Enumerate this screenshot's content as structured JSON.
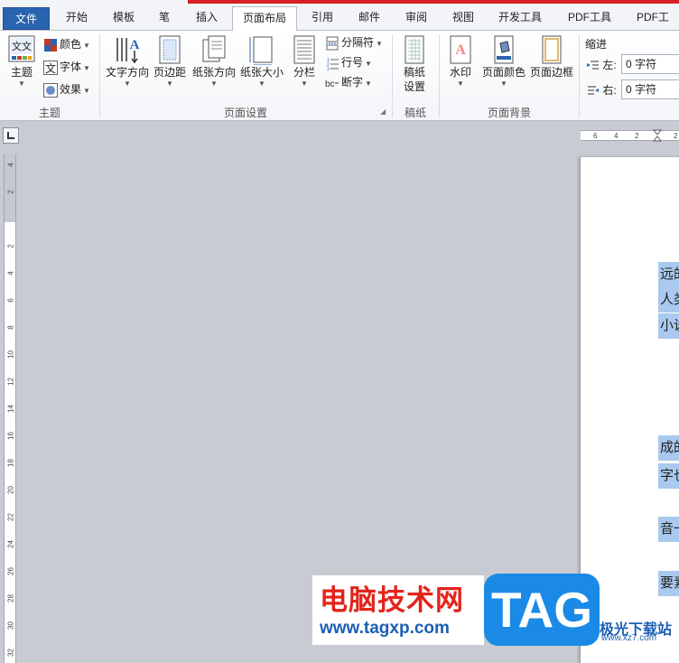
{
  "tabs": {
    "file": "文件",
    "items": [
      "开始",
      "模板",
      "笔",
      "插入",
      "页面布局",
      "引用",
      "邮件",
      "审阅",
      "视图",
      "开发工具",
      "PDF工具",
      "PDF工"
    ],
    "active": "页面布局"
  },
  "ribbon": {
    "theme_group": {
      "label": "主题",
      "theme_button": "主题",
      "colors": "颜色",
      "fonts": "字体",
      "effects": "效果"
    },
    "page_setup_group": {
      "label": "页面设置",
      "text_direction": "文字方向",
      "margins": "页边距",
      "orientation": "纸张方向",
      "size": "纸张大小",
      "columns": "分栏",
      "breaks": "分隔符",
      "line_numbers": "行号",
      "hyphenation": "断字"
    },
    "manuscript_group": {
      "label": "稿纸",
      "button_line1": "稿纸",
      "button_line2": "设置"
    },
    "page_background_group": {
      "label": "页面背景",
      "watermark": "水印",
      "page_color": "页面颜色",
      "page_borders": "页面边框"
    },
    "indent": {
      "title": "缩进",
      "left_label": "左:",
      "left_value": "0 字符",
      "right_label": "右:",
      "right_value": "0 字符"
    }
  },
  "rulers": {
    "horizontal": [
      "6",
      "4",
      "2",
      "",
      "2"
    ],
    "vertical": [
      "4",
      "2",
      "",
      "2",
      "4",
      "6",
      "8",
      "10",
      "12",
      "14",
      "16",
      "18",
      "20",
      "22",
      "24",
      "26",
      "28",
      "30",
      "32"
    ]
  },
  "document": {
    "lines": [
      "远的",
      "人类",
      "小说",
      "成的",
      "字也",
      "音一",
      "要素"
    ]
  },
  "watermark": {
    "title": "电脑技术网",
    "url": "www.tagxp.com",
    "tag": "TAG",
    "site_name": "极光下载站",
    "site_url": "www.xz7.com"
  },
  "colors": {
    "file_tab": "#2a63b0",
    "highlight": "#a9c9ee",
    "accent_red": "#d81f26"
  }
}
